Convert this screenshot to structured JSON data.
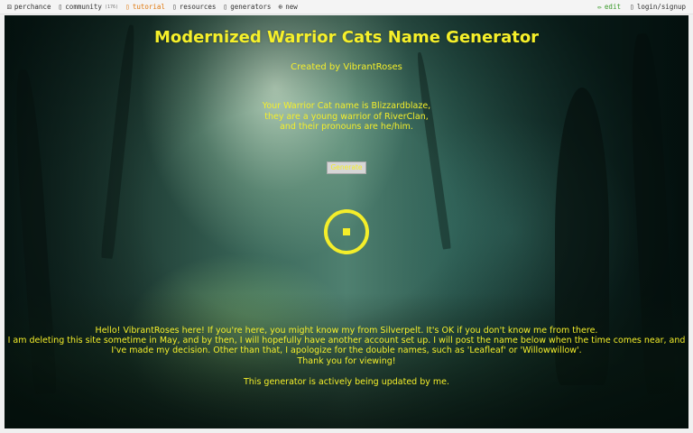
{
  "nav": {
    "left": [
      {
        "icon": "dice-icon",
        "glyph": "⚄",
        "label": "perchance"
      },
      {
        "icon": "community-icon",
        "glyph": "▯",
        "label": "community",
        "count": "(176)"
      },
      {
        "icon": "tutorial-icon",
        "glyph": "▯",
        "label": "tutorial",
        "color": "#e07a10"
      },
      {
        "icon": "resources-icon",
        "glyph": "▯",
        "label": "resources"
      },
      {
        "icon": "generators-icon",
        "glyph": "▯",
        "label": "generators"
      },
      {
        "icon": "new-icon",
        "glyph": "⊕",
        "label": "new"
      }
    ],
    "right": [
      {
        "icon": "pencil-icon",
        "glyph": "✏",
        "label": "edit",
        "color": "#3a9a2a"
      },
      {
        "icon": "login-icon",
        "glyph": "▯",
        "label": "login/signup"
      }
    ]
  },
  "main": {
    "title": "Modernized Warrior Cats Name Generator",
    "credit": "Created by VibrantRoses",
    "result": [
      "Your Warrior Cat name is Blizzardblaze,",
      "they are a young warrior of RiverClan,",
      "and their pronouns are he/him."
    ],
    "generate_label": "Generate",
    "message": [
      "Hello! VibrantRoses here! If you're here, you might know my from Silverpelt. It's OK if you don't know me from there.",
      "I am deleting this site sometime in May, and by then, I will hopefully have another account set up. I will post the name below when the time comes near, and",
      "I've made my decision. Other than that, I apologize for the double names, such as 'Leafleaf' or 'Willowwillow'.",
      "Thank you for viewing!"
    ],
    "footer": "This generator is actively being updated by me."
  },
  "colors": {
    "accent_text": "#f4ee2a",
    "nav_orange": "#e07a10",
    "nav_green": "#3a9a2a"
  }
}
